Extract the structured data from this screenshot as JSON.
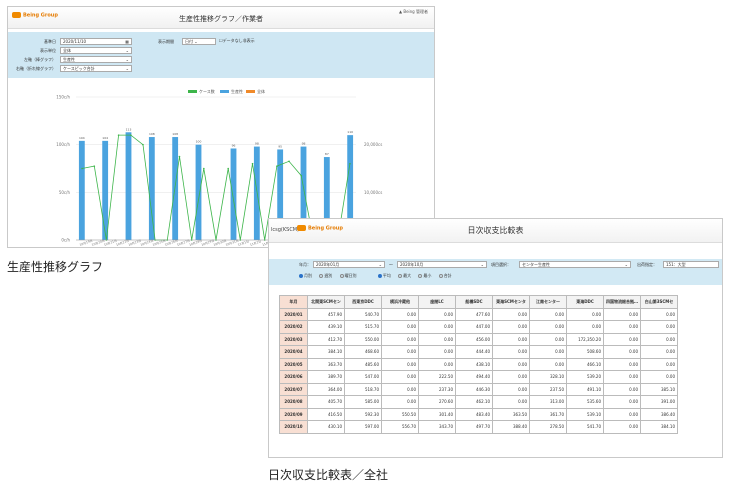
{
  "shot1": {
    "logo": "Being Group",
    "title": "生産性推移グラフ／作業者",
    "user": "Being 管理者",
    "form": {
      "rows": [
        {
          "label": "基準日",
          "value": "2020/11/10",
          "icon": "calendar-icon"
        },
        {
          "label": "表示単位",
          "value": "全体"
        },
        {
          "label": "左軸（棒グラフ）",
          "value": "生産性"
        },
        {
          "label": "右軸（折れ線グラフ）",
          "value": "ケースピック合計"
        }
      ],
      "span_label": "表示期間",
      "span_value": "日付",
      "checkbox_label": "データなし非表示"
    },
    "chart_data": {
      "type": "bar",
      "legend": [
        "ケース数",
        "生産性",
        "全体"
      ],
      "colors": {
        "bar": "#4aa3df",
        "line": "#3db54a",
        "legend3": "#f08a2a"
      },
      "y_left_ticks": [
        "0c/h",
        "50c/h",
        "100c/h",
        "150c/h"
      ],
      "y_right_ticks": [
        "0",
        "10,000cs",
        "20,000cs"
      ],
      "categories": [
        "10月19日",
        "10月20日",
        "10月21日",
        "10月22日",
        "10月23日",
        "10月24日",
        "10月25日",
        "10月26日",
        "10月27日",
        "10月28日",
        "10月29日",
        "10月30日",
        "10月31日",
        "11月1日",
        "11月2日",
        "11月3日",
        "11月4日",
        "11月5日",
        "11月6日",
        "11月7日",
        "11月8日",
        "11月9日",
        "11月10日"
      ],
      "bars": [
        104,
        0,
        104,
        0,
        113,
        0,
        108,
        0,
        108,
        0,
        100,
        0,
        0,
        96,
        0,
        98,
        0,
        95,
        0,
        98,
        0,
        87,
        0,
        110
      ],
      "line": [
        15000,
        15500,
        0,
        22000,
        22000,
        20000,
        0,
        0,
        17500,
        0,
        15000,
        0,
        15000,
        0,
        16000,
        0,
        15500,
        16500,
        13500,
        0,
        0,
        0,
        16000
      ],
      "ylim": [
        0,
        150
      ]
    }
  },
  "caption1": "生産性推移グラフ",
  "shot2": {
    "leftlbl": "lcsg(KSCM)",
    "logo": "Being Group",
    "title": "日次収支比較表",
    "filters": {
      "ym_label": "年月：",
      "from": "2020年01月",
      "sep": "～",
      "to": "2020年10月",
      "cat_label": "項目選択：",
      "cat_value": "センター生産性",
      "size_label": "出荷指定：",
      "size_value": "151：大型",
      "period_options": [
        "月別",
        "週別",
        "曜日別"
      ],
      "stat_options": [
        "平均",
        "最大",
        "最小",
        "合計"
      ]
    },
    "table": {
      "headers": [
        "年月",
        "北関東SCMセン",
        "西東京DDC",
        "横浜冷蔵他",
        "座間LC",
        "船橋SDC",
        "東海SCMセンタ",
        "江南センター",
        "東海DDC",
        "四国物流総合拠…",
        "白山第3SCMセ"
      ],
      "rows": [
        [
          "2020/01",
          "457.90",
          "540.70",
          "0.00",
          "0.00",
          "477.60",
          "0.00",
          "0.00",
          "0.00",
          "0.00",
          "0.00"
        ],
        [
          "2020/02",
          "439.10",
          "515.70",
          "0.00",
          "0.00",
          "447.00",
          "0.00",
          "0.00",
          "0.00",
          "0.00",
          "0.00"
        ],
        [
          "2020/03",
          "412.70",
          "550.00",
          "0.00",
          "0.00",
          "456.00",
          "0.00",
          "0.00",
          "172,350.20",
          "0.00",
          "0.00"
        ],
        [
          "2020/04",
          "384.10",
          "468.60",
          "0.00",
          "0.00",
          "444.40",
          "0.00",
          "0.00",
          "508.60",
          "0.00",
          "0.00"
        ],
        [
          "2020/05",
          "363.70",
          "485.60",
          "0.00",
          "0.00",
          "438.10",
          "0.00",
          "0.00",
          "466.10",
          "0.00",
          "0.00"
        ],
        [
          "2020/06",
          "389.70",
          "547.00",
          "0.00",
          "222.50",
          "494.40",
          "0.00",
          "328.10",
          "539.20",
          "0.00",
          "0.00"
        ],
        [
          "2020/07",
          "364.00",
          "518.70",
          "0.00",
          "237.30",
          "446.30",
          "0.00",
          "237.50",
          "491.10",
          "0.00",
          "385.10"
        ],
        [
          "2020/08",
          "405.70",
          "585.00",
          "0.00",
          "270.60",
          "462.10",
          "0.00",
          "313.00",
          "535.60",
          "0.00",
          "391.00"
        ],
        [
          "2020/09",
          "416.50",
          "592.30",
          "550.50",
          "301.40",
          "483.40",
          "363.50",
          "361.70",
          "539.10",
          "0.00",
          "386.40"
        ],
        [
          "2020/10",
          "430.10",
          "597.00",
          "556.70",
          "343.70",
          "497.70",
          "388.40",
          "278.50",
          "541.70",
          "0.00",
          "384.10"
        ]
      ]
    }
  },
  "caption2": "日次収支比較表／全社"
}
